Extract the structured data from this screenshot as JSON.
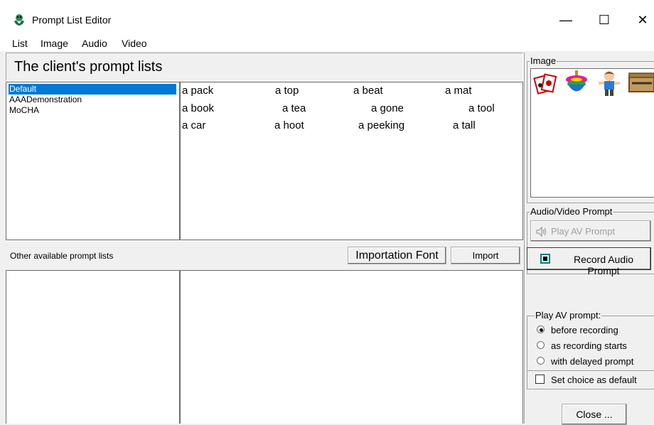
{
  "window": {
    "title": "Prompt List Editor",
    "minimize_glyph": "—",
    "maximize_glyph": "☐",
    "close_glyph": "✕"
  },
  "menu": [
    "List",
    "Image",
    "Audio",
    "Video"
  ],
  "heading": "The client's prompt lists",
  "client_lists": [
    "Default",
    "AAADemonstration",
    "MoCHA"
  ],
  "selected_list": "Default",
  "prompt_rows": [
    [
      "a pack",
      "a top",
      "a beat",
      "a mat"
    ],
    [
      "a book",
      "a tea",
      "a gone",
      "a tool"
    ],
    [
      "a car",
      "a hoot",
      "a peeking",
      "a tall"
    ]
  ],
  "other_lists_label": "Other available prompt lists",
  "importation_font_label": "Importation Font",
  "import_label": "Import",
  "image_group_label": "Image",
  "image_thumbnails": [
    "card-picture",
    "spinning-top-picture",
    "boy-picture",
    "box-picture"
  ],
  "av_group_label": "Audio/Video Prompt",
  "play_av_label": "Play AV Prompt",
  "record_audio_label": "Record Audio Prompt",
  "play_group_label": "Play AV prompt:",
  "play_options": [
    "before recording",
    "as recording starts",
    "with delayed prompt"
  ],
  "play_selected_index": 0,
  "set_default_label": "Set choice as default",
  "set_default_checked": false,
  "close_label": "Close ...",
  "colors": {
    "selection": "#0078d7",
    "record_icon_border": "#008080"
  }
}
